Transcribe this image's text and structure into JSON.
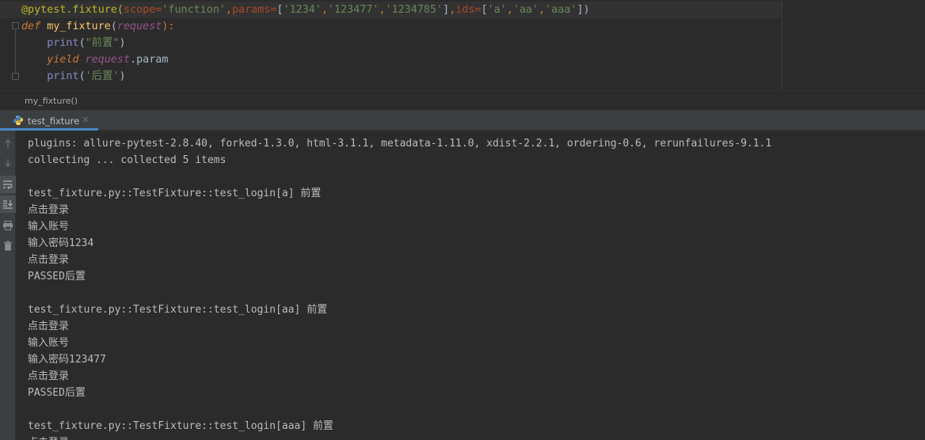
{
  "editor": {
    "lines": [
      [
        {
          "t": "@pytest.fixture(",
          "c": "c-ann"
        },
        {
          "t": "scope=",
          "c": "c-param"
        },
        {
          "t": "'function'",
          "c": "c-str"
        },
        {
          "t": ",",
          "c": "c-kw"
        },
        {
          "t": "params=",
          "c": "c-param"
        },
        {
          "t": "[",
          "c": "c-plain"
        },
        {
          "t": "'1234'",
          "c": "c-str"
        },
        {
          "t": ",",
          "c": "c-kw"
        },
        {
          "t": "'123477'",
          "c": "c-str"
        },
        {
          "t": ",",
          "c": "c-kw"
        },
        {
          "t": "'1234785'",
          "c": "c-str"
        },
        {
          "t": "]",
          "c": "c-plain"
        },
        {
          "t": ",",
          "c": "c-kw"
        },
        {
          "t": "ids=",
          "c": "c-param"
        },
        {
          "t": "[",
          "c": "c-plain"
        },
        {
          "t": "'a'",
          "c": "c-str"
        },
        {
          "t": ",",
          "c": "c-kw"
        },
        {
          "t": "'aa'",
          "c": "c-str"
        },
        {
          "t": ",",
          "c": "c-kw"
        },
        {
          "t": "'aaa'",
          "c": "c-str"
        },
        {
          "t": "])",
          "c": "c-plain"
        }
      ],
      [
        {
          "t": "def ",
          "c": "c-def"
        },
        {
          "t": "my_fixture",
          "c": "c-fn"
        },
        {
          "t": "(",
          "c": "c-plain"
        },
        {
          "t": "request",
          "c": "c-req"
        },
        {
          "t": "):",
          "c": "c-kw"
        }
      ],
      [
        {
          "t": "    ",
          "c": "c-plain"
        },
        {
          "t": "print",
          "c": "c-builtin"
        },
        {
          "t": "(",
          "c": "c-plain"
        },
        {
          "t": "\"前置\"",
          "c": "c-str"
        },
        {
          "t": ")",
          "c": "c-plain"
        }
      ],
      [
        {
          "t": "    ",
          "c": "c-plain"
        },
        {
          "t": "yield ",
          "c": "c-yield"
        },
        {
          "t": "request",
          "c": "c-req"
        },
        {
          "t": ".param",
          "c": "c-plain"
        }
      ],
      [
        {
          "t": "    ",
          "c": "c-plain"
        },
        {
          "t": "print",
          "c": "c-builtin"
        },
        {
          "t": "(",
          "c": "c-plain"
        },
        {
          "t": "'后置'",
          "c": "c-str"
        },
        {
          "t": ")",
          "c": "c-plain"
        }
      ]
    ]
  },
  "breadcrumb": {
    "text": "my_fixture()"
  },
  "run_tab": {
    "label": "test_fixture",
    "close": "×",
    "icon": "python-icon"
  },
  "toolstrip": {
    "icons": [
      "scroll-up-icon",
      "scroll-down-icon",
      "soft-wrap-icon",
      "scroll-to-end-icon",
      "print-icon",
      "trash-icon"
    ]
  },
  "console": {
    "clipped_line": "                                                       ",
    "lines": [
      "plugins: allure-pytest-2.8.40, forked-1.3.0, html-3.1.1, metadata-1.11.0, xdist-2.2.1, ordering-0.6, rerunfailures-9.1.1",
      "collecting ... collected 5 items",
      "",
      "test_fixture.py::TestFixture::test_login[a] 前置",
      "点击登录",
      "输入账号",
      "输入密码1234",
      "点击登录",
      "PASSED后置",
      "",
      "test_fixture.py::TestFixture::test_login[aa] 前置",
      "点击登录",
      "输入账号",
      "输入密码123477",
      "点击登录",
      "PASSED后置",
      "",
      "test_fixture.py::TestFixture::test_login[aaa] 前置",
      "点击登录"
    ]
  }
}
